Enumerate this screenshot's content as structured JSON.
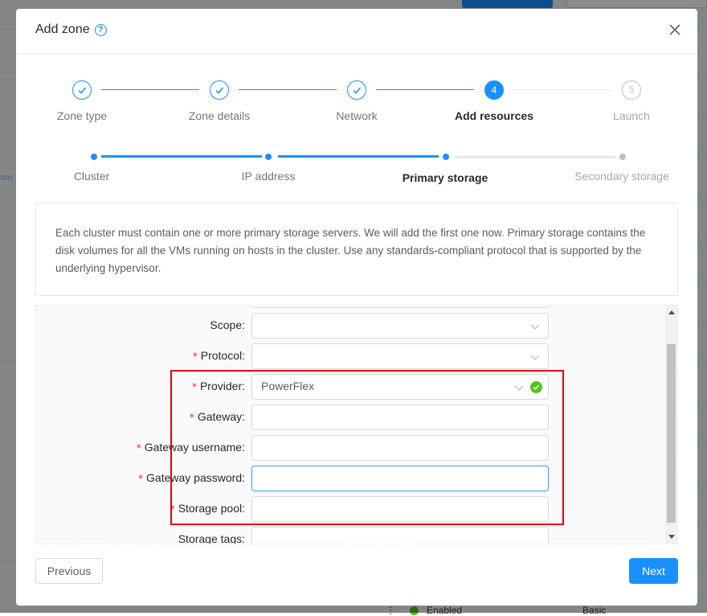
{
  "modal": {
    "title": "Add zone",
    "close_icon": "close-icon",
    "help_icon": "question-circle-icon"
  },
  "main_steps": [
    {
      "label": "Zone type",
      "status": "finished"
    },
    {
      "label": "Zone details",
      "status": "finished"
    },
    {
      "label": "Network",
      "status": "finished"
    },
    {
      "label": "Add resources",
      "status": "active",
      "number": "4"
    },
    {
      "label": "Launch",
      "status": "wait",
      "number": "5"
    }
  ],
  "sub_steps": [
    {
      "label": "Cluster",
      "status": "finished"
    },
    {
      "label": "IP address",
      "status": "finished"
    },
    {
      "label": "Primary storage",
      "status": "active"
    },
    {
      "label": "Secondary storage",
      "status": "wait"
    }
  ],
  "description": "Each cluster must contain one or more primary storage servers. We will add the first one now. Primary storage contains the disk volumes for all the VMs running on hosts in the cluster. Use any standards-compliant protocol that is supported by the underlying hypervisor.",
  "form": {
    "fields": [
      {
        "label": "Scope",
        "required": false,
        "type": "select",
        "value": ""
      },
      {
        "label": "Protocol",
        "required": true,
        "type": "select",
        "value": ""
      },
      {
        "label": "Provider",
        "required": true,
        "type": "select",
        "value": "PowerFlex",
        "validated": true
      },
      {
        "label": "Gateway",
        "required": true,
        "type": "text",
        "value": ""
      },
      {
        "label": "Gateway username",
        "required": true,
        "type": "text",
        "value": ""
      },
      {
        "label": "Gateway password",
        "required": true,
        "type": "password",
        "value": "",
        "focused": true
      },
      {
        "label": "Storage pool",
        "required": true,
        "type": "text",
        "value": ""
      },
      {
        "label": "Storage tags",
        "required": false,
        "type": "text",
        "value": ""
      }
    ],
    "label_separator": ":"
  },
  "footer": {
    "previous_label": "Previous",
    "next_label": "Next"
  },
  "background": {
    "status_text": "Enabled",
    "type_text": "Basic"
  },
  "colors": {
    "primary": "#1890ff",
    "success": "#52c41a",
    "required": "#f5222d",
    "highlight": "#e60012"
  }
}
